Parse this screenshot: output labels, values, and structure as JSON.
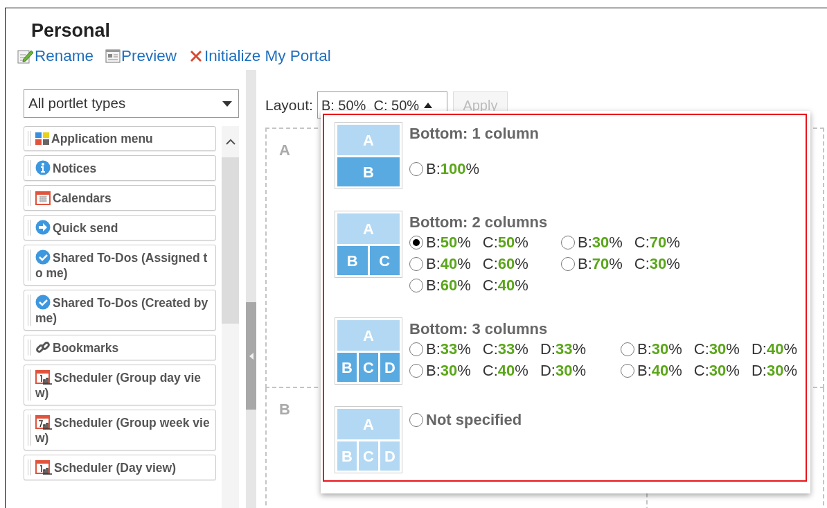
{
  "page": {
    "title": "Personal"
  },
  "actions": [
    {
      "label": "Rename",
      "kind": "rename"
    },
    {
      "label": "Preview",
      "kind": "preview"
    },
    {
      "label": "Initialize My Portal",
      "kind": "initialize"
    }
  ],
  "portlet_filter": {
    "value": "All portlet types"
  },
  "portlets": [
    {
      "label": "Application menu",
      "kind": "apps"
    },
    {
      "label": "Notices",
      "kind": "info"
    },
    {
      "label": "Calendars",
      "kind": "calendar"
    },
    {
      "label": "Quick send",
      "kind": "send"
    },
    {
      "label": "Shared To-Dos (Assigned to me)",
      "kind": "todo"
    },
    {
      "label": "Shared To-Dos (Created by me)",
      "kind": "todo"
    },
    {
      "label": "Bookmarks",
      "kind": "link"
    },
    {
      "label": "Scheduler (Group day view)",
      "kind": "sched_day"
    },
    {
      "label": "Scheduler (Group week view)",
      "kind": "sched_week"
    },
    {
      "label": "Scheduler (Day view)",
      "kind": "sched_day"
    }
  ],
  "layout": {
    "label": "Layout:",
    "value": "B: 50%  C: 50%",
    "expanded": true,
    "apply": {
      "label": "Apply",
      "disabled": true
    }
  },
  "zones": [
    "A",
    "B"
  ],
  "layout_groups": [
    {
      "kind": "one",
      "title": "Bottom: 1 column",
      "thumbnail": {
        "top": "A",
        "bottom": [
          "B"
        ]
      },
      "options": [
        {
          "parts": [
            "B:**100**%"
          ],
          "selected": false
        }
      ]
    },
    {
      "kind": "two",
      "title": "Bottom: 2 columns",
      "thumbnail": {
        "top": "A",
        "bottom": [
          "B",
          "C"
        ]
      },
      "options": [
        {
          "parts": [
            "B:**50**%",
            "C:**50**%"
          ],
          "selected": true
        },
        {
          "parts": [
            "B:**30**%",
            "C:**70**%"
          ],
          "selected": false
        },
        {
          "parts": [
            "B:**40**%",
            "C:**60**%"
          ],
          "selected": false
        },
        {
          "parts": [
            "B:**70**%",
            "C:**30**%"
          ],
          "selected": false
        },
        {
          "parts": [
            "B:**60**%",
            "C:**40**%"
          ],
          "selected": false
        }
      ]
    },
    {
      "kind": "three",
      "title": "Bottom: 3 columns",
      "thumbnail": {
        "top": "A",
        "bottom": [
          "B",
          "C",
          "D"
        ]
      },
      "options": [
        {
          "parts": [
            "B:**33**%",
            "C:**33**%",
            "D:**33**%"
          ],
          "selected": false
        },
        {
          "parts": [
            "B:**30**%",
            "C:**30**%",
            "D:**40**%"
          ],
          "selected": false
        },
        {
          "parts": [
            "B:**30**%",
            "C:**40**%",
            "D:**30**%"
          ],
          "selected": false
        },
        {
          "parts": [
            "B:**40**%",
            "C:**30**%",
            "D:**30**%"
          ],
          "selected": false
        }
      ]
    },
    {
      "kind": "unspecified",
      "thumbnail": {
        "top": "A",
        "bottom": [
          "B",
          "C",
          "D"
        ]
      },
      "options": [
        {
          "parts": [
            "Not specified"
          ],
          "selected": false
        }
      ]
    }
  ]
}
